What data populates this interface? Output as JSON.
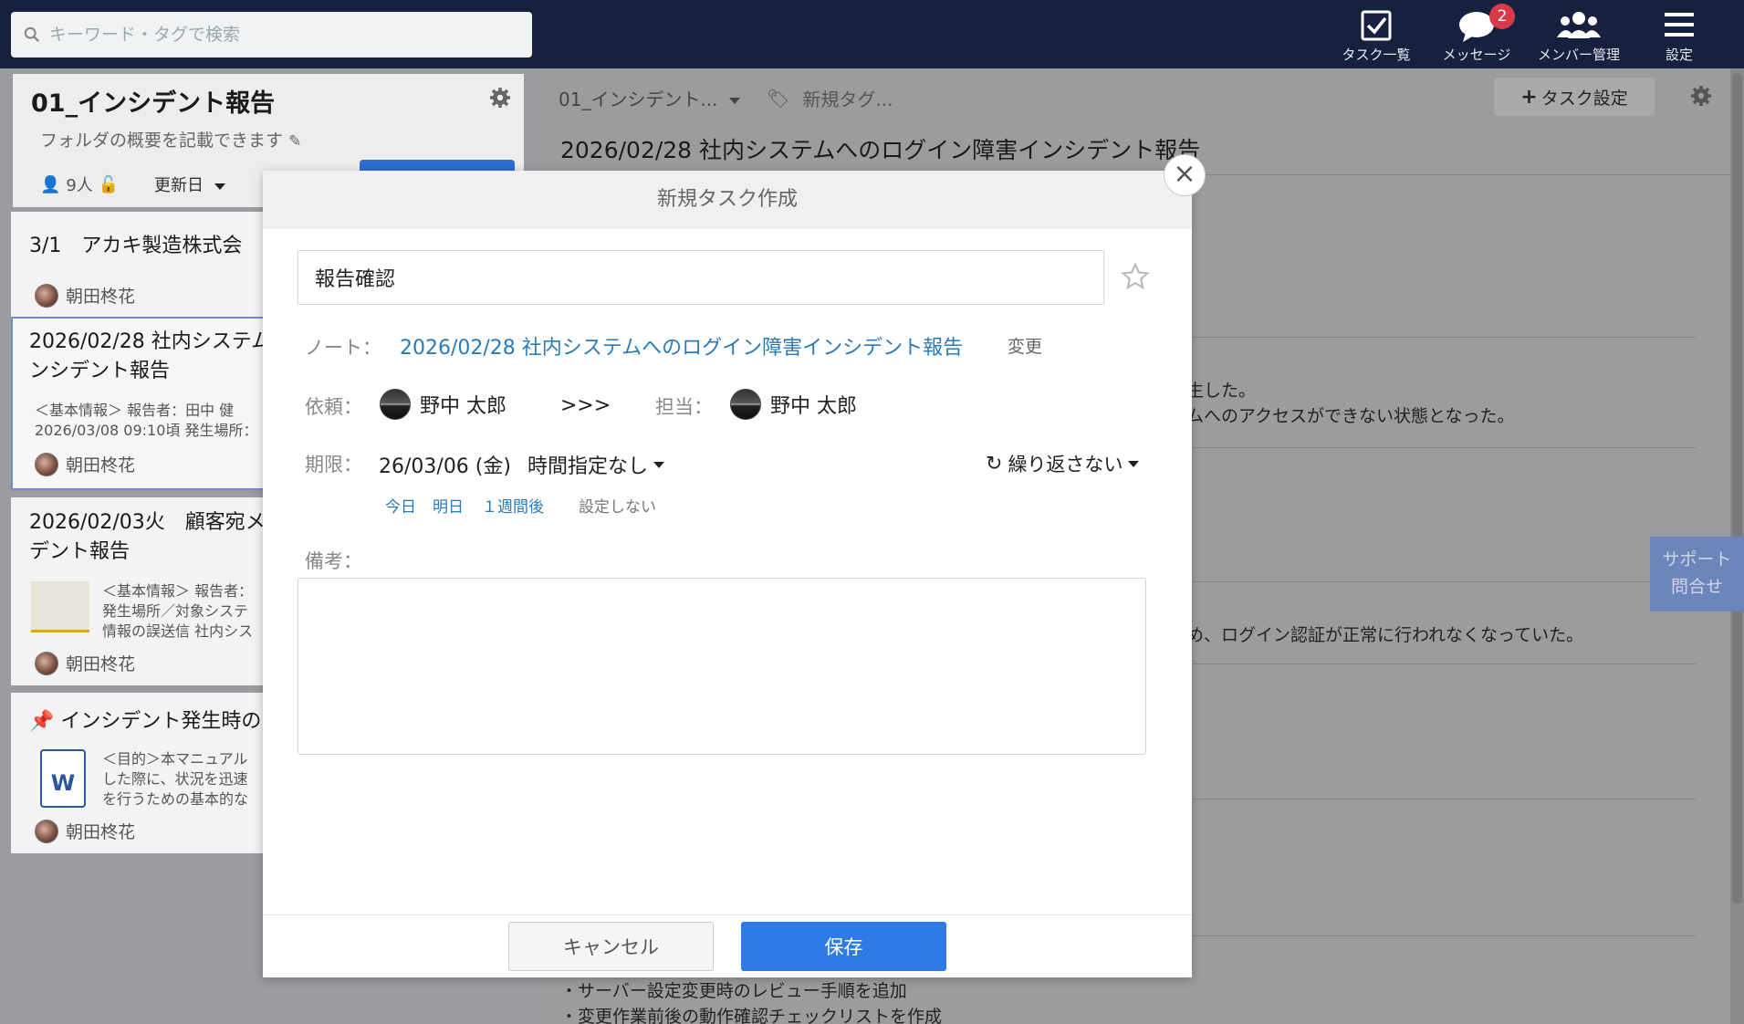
{
  "search": {
    "placeholder": "キーワード・タグで検索"
  },
  "nav": [
    {
      "label": "タスク一覧",
      "icon": "checkbox-icon"
    },
    {
      "label": "メッセージ",
      "icon": "chat-bubble-icon",
      "badge": "2"
    },
    {
      "label": "メンバー管理",
      "icon": "members-icon"
    },
    {
      "label": "設定",
      "icon": "menu-icon"
    }
  ],
  "folder": {
    "title": "01_インシデント報告",
    "description": "フォルダの概要を記載できます",
    "members": "9人",
    "sort": "更新日"
  },
  "cards": [
    {
      "title": "3/1　アカキ製造株式会",
      "user": "朝田柊花"
    },
    {
      "title_line1": "2026/02/28 社内システム",
      "title_line2": "ンシデント報告",
      "body_line1": "＜基本情報＞ 報告者：田中 健",
      "body_line2": "2026/03/08 09:10頃 発生場所：",
      "user": "朝田柊花"
    },
    {
      "title_line1": "2026/02/03火　顧客宛メ",
      "title_line2": "デント報告",
      "body_line1": "＜基本情報＞ 報告者：",
      "body_line2": "発生場所／対象システ",
      "body_line3": "情報の誤送信 社内シス",
      "user": "朝田柊花"
    },
    {
      "title": "インシデント発生時の",
      "body_line1": "＜目的＞本マニュアル",
      "body_line2": "した際に、状況を迅速",
      "body_line3": "を行うための基本的な",
      "user": "朝田柊花"
    }
  ],
  "right": {
    "crumb": "01_インシデント...",
    "new_tag": "新規タグ...",
    "task_setting": "タスク設定",
    "note_title": "2026/02/28 社内システムへのログイン障害インシデント報告",
    "text1": "生した。",
    "text2": "ムへのアクセスができない状態となった。",
    "text3": "め、ログイン認証が正常に行われなくなっていた。",
    "text4": "・サーバー設定変更時のレビュー手順を追加",
    "text5": "・変更作業前後の動作確認チェックリストを作成",
    "support_line1": "サポート",
    "support_line2": "問合せ"
  },
  "modal": {
    "header": "新規タスク作成",
    "task_title": "報告確認",
    "note_label": "ノート：",
    "note_link": "2026/02/28 社内システムへのログイン障害インシデント報告",
    "note_change": "変更",
    "request_label": "依頼：",
    "requester": "野中 太郎",
    "arrow": ">>>",
    "assignee_label": "担当：",
    "assignee": "野中 太郎",
    "deadline_label": "期限：",
    "date": "26/03/06 (金)",
    "time": "時間指定なし",
    "repeat": "繰り返さない",
    "quick_today": "今日",
    "quick_tomorrow": "明日",
    "quick_week": "１週間後",
    "quick_none": "設定しない",
    "memo_label": "備考：",
    "cancel": "キャンセル",
    "save": "保存"
  }
}
